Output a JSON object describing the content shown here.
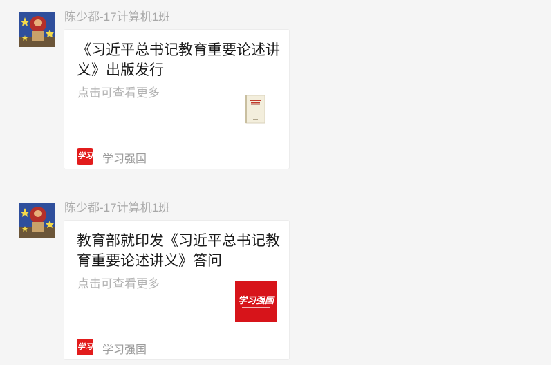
{
  "messages": [
    {
      "sender": "陈少都-17计算机1班",
      "card": {
        "title": "《习近平总书记教育重要论述讲义》出版发行",
        "description": "点击可查看更多",
        "thumbnail": "book-cover",
        "source_icon": "学习强国",
        "source_name": "学习强国"
      }
    },
    {
      "sender": "陈少都-17计算机1班",
      "card": {
        "title": "教育部就印发《习近平总书记教育重要论述讲义》答问",
        "description": "点击可查看更多",
        "thumbnail": "xuexi-logo",
        "thumbnail_text": "学习强国",
        "source_icon": "学习强国",
        "source_name": "学习强国"
      }
    }
  ],
  "colors": {
    "background": "#f5f5f5",
    "card": "#ffffff",
    "brand_red": "#e21c1c",
    "muted_text": "#a8a8a8"
  }
}
